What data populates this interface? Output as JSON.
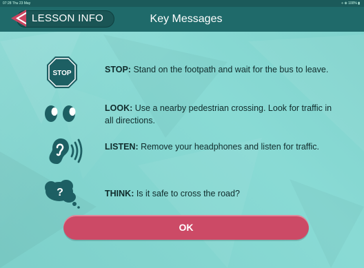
{
  "statusbar": {
    "time": "07:28  Thu 23 May",
    "indicators": "⋄ ⊕ 100% ▮"
  },
  "header": {
    "back_label": "LESSON INFO",
    "title": "Key Messages"
  },
  "messages": [
    {
      "keyword": "STOP:",
      "text": " Stand on the footpath and wait for the bus to leave.",
      "icon": "stop-sign-icon",
      "icon_label": "STOP"
    },
    {
      "keyword": "LOOK:",
      "text": " Use a nearby pedestrian crossing. Look for traffic in all directions.",
      "icon": "eyes-icon"
    },
    {
      "keyword": "LISTEN:",
      "text": " Remove your headphones and listen for traffic.",
      "icon": "ear-icon"
    },
    {
      "keyword": "THINK:",
      "text": " Is it safe to cross the road?",
      "icon": "thought-bubble-icon",
      "icon_label": "?"
    }
  ],
  "ok_button": {
    "label": "OK"
  },
  "colors": {
    "header": "#1f6a6a",
    "background": "#82d8d2",
    "ok": "#cc4a66",
    "icon": "#1d5f63"
  }
}
